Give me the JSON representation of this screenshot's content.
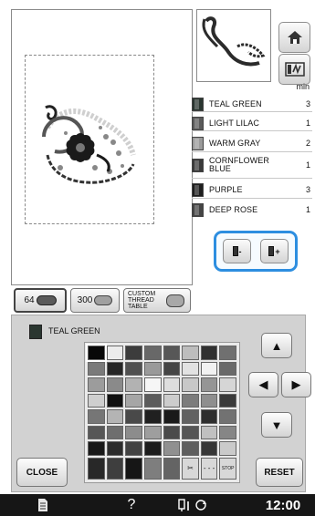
{
  "thread_list": {
    "unit_label": "min",
    "items": [
      {
        "name": "TEAL GREEN",
        "count": "3",
        "color": "#2a3630"
      },
      {
        "name": "LIGHT LILAC",
        "count": "1",
        "color": "#5a5a5a"
      },
      {
        "name": "WARM GRAY",
        "count": "2",
        "color": "#9a9a9a"
      },
      {
        "name": "CORNFLOWER BLUE",
        "count": "1",
        "color": "#3a3a3a"
      },
      {
        "name": "PURPLE",
        "count": "3",
        "color": "#1e1e1e"
      },
      {
        "name": "DEEP ROSE",
        "count": "1",
        "color": "#444444"
      }
    ]
  },
  "stepper": {
    "minus_label": "-",
    "plus_label": "+"
  },
  "palette_tabs": {
    "tab_64": "64",
    "tab_300": "300",
    "custom_table": "CUSTOM THREAD TABLE"
  },
  "selected_thread": {
    "name": "TEAL GREEN",
    "color": "#2a3630"
  },
  "thread_grid": {
    "colors": [
      "#080808",
      "#ececec",
      "#3c3c3c",
      "#686868",
      "#575757",
      "#bdbdbd",
      "#303030",
      "#707070",
      "#7a7a7a",
      "#262626",
      "#505050",
      "#9a9a9a",
      "#454545",
      "#e2e2e2",
      "#f2f2f2",
      "#6a6a6a",
      "#9c9c9c",
      "#8a8a8a",
      "#b2b2b2",
      "#f6f6f6",
      "#dedede",
      "#c8c8c8",
      "#959595",
      "#d6d6d6",
      "#cfcfcf",
      "#111111",
      "#a6a6a6",
      "#5c5c5c",
      "#cccccc",
      "#7c7c7c",
      "#8e8e8e",
      "#3a3a3a",
      "#767676",
      "#b4b4b4",
      "#494949",
      "#202020",
      "#1a1a1a",
      "#616161",
      "#2e2e2e",
      "#727272",
      "#575757",
      "#6e6e6e",
      "#8c8c8c",
      "#9e9e9e",
      "#4a4a4a",
      "#555555",
      "#c0c0c0",
      "#868686",
      "#181818",
      "#2c2c2c",
      "#424242",
      "#1c1c1c",
      "#909090",
      "#5e5e5e",
      "#363636",
      "#cacaca",
      "#282828",
      "#3e3e3e",
      "#161616",
      "#7e7e7e",
      "#646464",
      "#d8d8d8",
      "#e0e0e0",
      "#e6e6e6"
    ],
    "special_labels": {
      "scissors": "✂",
      "dashes": "- - -",
      "stop": "STOP"
    }
  },
  "buttons": {
    "close": "CLOSE",
    "reset": "RESET"
  },
  "status_bar": {
    "help": "?",
    "time": "12:00"
  }
}
